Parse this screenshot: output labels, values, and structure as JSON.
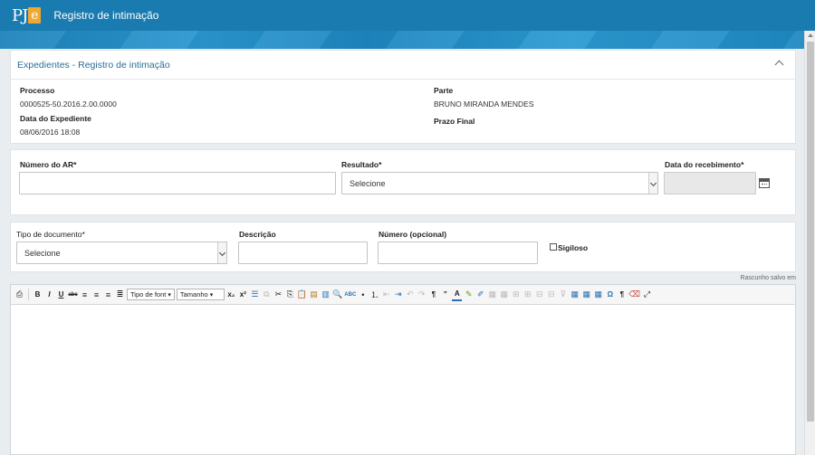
{
  "app": {
    "logo_text": "PJ",
    "logo_e": "e",
    "title": "Registro de intimação"
  },
  "panel1": {
    "title": "Expedientes - Registro de intimação",
    "processo_label": "Processo",
    "processo_value": "0000525-50.2016.2.00.0000",
    "data_label": "Data do Expediente",
    "data_value": "08/06/2016 18:08",
    "parte_label": "Parte",
    "parte_value": "BRUNO MIRANDA MENDES",
    "prazo_label": "Prazo Final"
  },
  "panel2": {
    "numero_ar_label": "Número do AR*",
    "resultado_label": "Resultado*",
    "resultado_value": "Selecione",
    "data_recebimento_label": "Data do recebimento*"
  },
  "panel3": {
    "tipo_label": "Tipo de documento*",
    "tipo_value": "Selecione",
    "descricao_label": "Descrição",
    "numero_label": "Número (opcional)",
    "sigiloso_label": "Sigiloso"
  },
  "editor": {
    "draft_status": "Rascunho salvo em",
    "font_dropdown": "Tipo de font",
    "size_dropdown": "Tamanho",
    "icons": [
      "print-icon",
      "bold-icon",
      "italic-icon",
      "underline-icon",
      "strikethrough-icon",
      "align-left-icon",
      "align-center-icon",
      "align-right-icon",
      "justify-icon",
      "subscript-icon",
      "superscript-icon",
      "list-icon",
      "cut-icon",
      "copy-icon",
      "paste-icon",
      "paste-text-icon",
      "paste-word-icon",
      "find-icon",
      "spellcheck-icon",
      "bullet-list-icon",
      "numbered-list-icon",
      "outdent-icon",
      "indent-icon",
      "undo-icon",
      "redo-icon",
      "paragraph-icon",
      "quote-icon",
      "text-color-icon",
      "highlight-icon",
      "edit-icon",
      "table-icon",
      "omega-icon",
      "pilcrow-icon",
      "eraser-icon",
      "fullscreen-icon"
    ]
  }
}
